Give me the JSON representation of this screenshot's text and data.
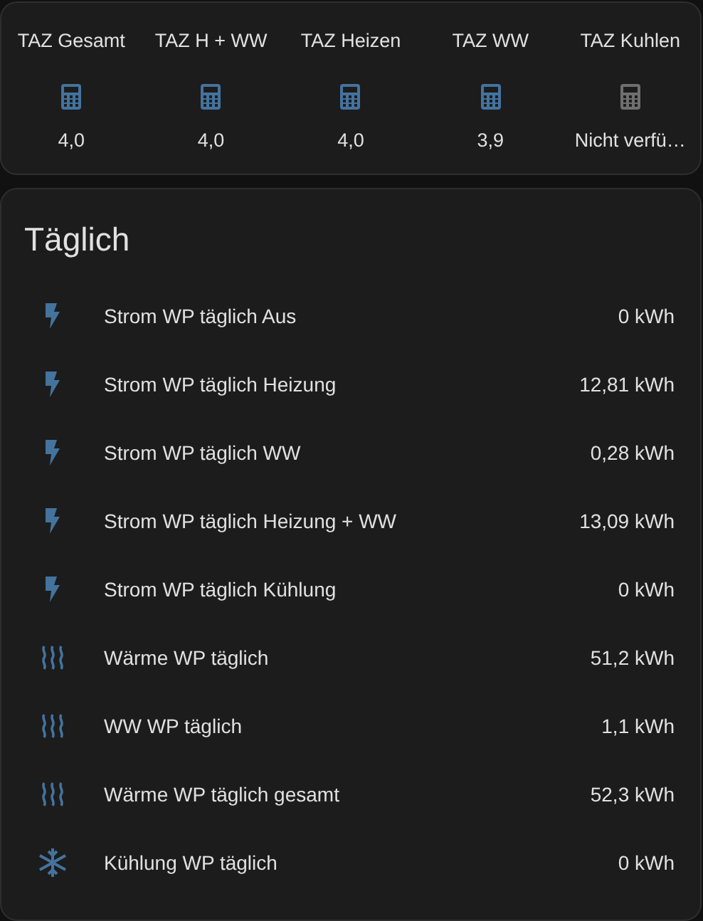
{
  "glance": [
    {
      "name": "TAZ Gesamt",
      "value": "4,0",
      "available": true
    },
    {
      "name": "TAZ H + WW",
      "value": "4,0",
      "available": true
    },
    {
      "name": "TAZ Heizen",
      "value": "4,0",
      "available": true
    },
    {
      "name": "TAZ WW",
      "value": "3,9",
      "available": true
    },
    {
      "name": "TAZ Kuhlen",
      "value": "Nicht verfü…",
      "available": false
    }
  ],
  "daily": {
    "title": "Täglich",
    "rows": [
      {
        "kind": "power",
        "name": "Strom WP täglich Aus",
        "value": "0 kWh"
      },
      {
        "kind": "power",
        "name": "Strom WP täglich Heizung",
        "value": "12,81 kWh"
      },
      {
        "kind": "power",
        "name": "Strom WP täglich WW",
        "value": "0,28 kWh"
      },
      {
        "kind": "power",
        "name": "Strom WP täglich Heizung + WW",
        "value": "13,09 kWh"
      },
      {
        "kind": "power",
        "name": "Strom WP täglich Kühlung",
        "value": "0 kWh"
      },
      {
        "kind": "heat",
        "name": "Wärme WP täglich",
        "value": "51,2 kWh"
      },
      {
        "kind": "heat",
        "name": "WW WP täglich",
        "value": "1,1 kWh"
      },
      {
        "kind": "heat",
        "name": "Wärme WP täglich gesamt",
        "value": "52,3 kWh"
      },
      {
        "kind": "cool",
        "name": "Kühlung WP täglich",
        "value": "0 kWh"
      }
    ]
  }
}
